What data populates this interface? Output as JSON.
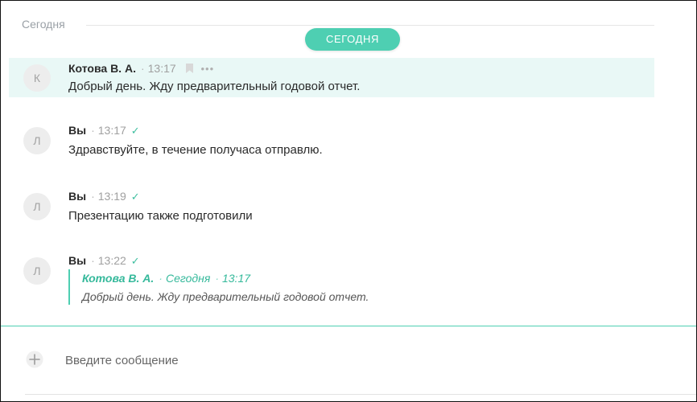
{
  "separator": {
    "label": "Сегодня",
    "pill": "СЕГОДНЯ"
  },
  "messages": [
    {
      "avatar": "К",
      "author": "Котова В. А.",
      "time": "13:17",
      "text": "Добрый день. Жду предварительный годовой отчет.",
      "highlighted": true,
      "icons": [
        "bookmark-icon",
        "more-icon"
      ],
      "more": "•••"
    },
    {
      "avatar": "Л",
      "author": "Вы",
      "time": "13:17",
      "check": "✓",
      "text": "Здравствуйте, в течение получаса отправлю."
    },
    {
      "avatar": "Л",
      "author": "Вы",
      "time": "13:19",
      "check": "✓",
      "text": "Презентацию также подготовили"
    },
    {
      "avatar": "Л",
      "author": "Вы",
      "time": "13:22",
      "check": "✓",
      "quote": {
        "author": "Котова В. А.",
        "day": "Сегодня",
        "time": "13:17",
        "text": "Добрый день. Жду предварительный годовой отчет."
      }
    }
  ],
  "composer": {
    "placeholder": "Введите сообщение",
    "add_icon": "plus-icon"
  },
  "colors": {
    "accent": "#4ecfb2",
    "highlight_bg": "#e9f8f6",
    "check": "#3fbfa0"
  }
}
